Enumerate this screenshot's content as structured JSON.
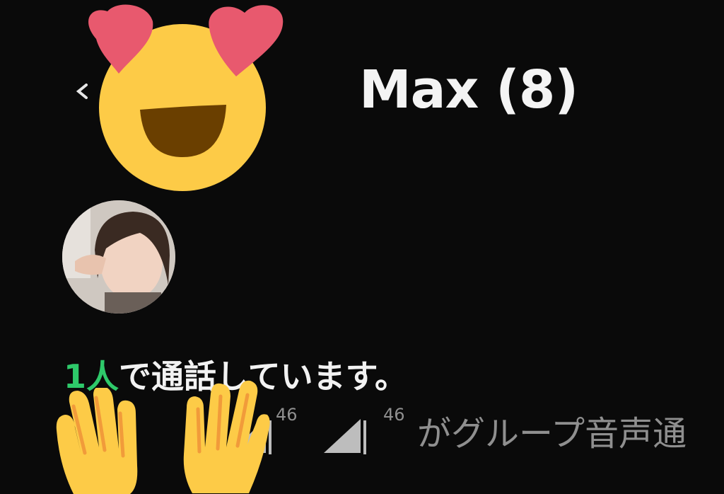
{
  "header": {
    "title": "Max (8)",
    "back_icon": "chevron-left-icon"
  },
  "overlay": {
    "face_emoji": "heart-eyes-emoji",
    "hands_emoji": "raising-hands-emoji"
  },
  "participant": {
    "avatar_icon": "user-avatar"
  },
  "call": {
    "count": "1人",
    "status_suffix": "で通話しています。"
  },
  "notification": {
    "signal_1": "46",
    "signal_2": "46",
    "text": "がグループ音声通"
  },
  "colors": {
    "background": "#0a0a0a",
    "accent_green": "#2ec96a",
    "emoji_yellow": "#fdcb47",
    "heart_pink": "#e8596e"
  }
}
